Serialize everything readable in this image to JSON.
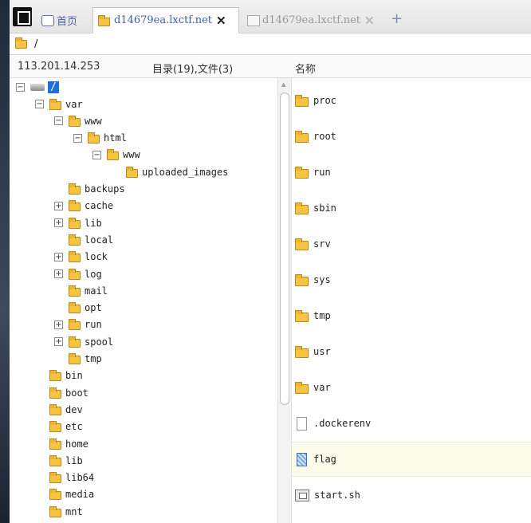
{
  "tabs": {
    "home": "首页",
    "active": "d14679ea.lxctf.net",
    "inactive": "d14679ea.lxctf.net",
    "close": "✕",
    "add": "+"
  },
  "address": {
    "path": "/"
  },
  "header": {
    "ip": "113.201.14.253",
    "counts": "目录(19),文件(3)",
    "name_col": "名称"
  },
  "tree": {
    "root": "/",
    "nodes": [
      {
        "label": "var",
        "toggle": "−"
      },
      {
        "label": "www",
        "toggle": "−"
      },
      {
        "label": "html",
        "toggle": "−"
      },
      {
        "label": "www",
        "toggle": "−"
      },
      {
        "label": "uploaded_images",
        "toggle": ""
      },
      {
        "label": "backups",
        "toggle": ""
      },
      {
        "label": "cache",
        "toggle": "+"
      },
      {
        "label": "lib",
        "toggle": "+"
      },
      {
        "label": "local",
        "toggle": ""
      },
      {
        "label": "lock",
        "toggle": "+"
      },
      {
        "label": "log",
        "toggle": "+"
      },
      {
        "label": "mail",
        "toggle": ""
      },
      {
        "label": "opt",
        "toggle": ""
      },
      {
        "label": "run",
        "toggle": "+"
      },
      {
        "label": "spool",
        "toggle": "+"
      },
      {
        "label": "tmp",
        "toggle": ""
      },
      {
        "label": "bin",
        "toggle": ""
      },
      {
        "label": "boot",
        "toggle": ""
      },
      {
        "label": "dev",
        "toggle": ""
      },
      {
        "label": "etc",
        "toggle": ""
      },
      {
        "label": "home",
        "toggle": ""
      },
      {
        "label": "lib",
        "toggle": ""
      },
      {
        "label": "lib64",
        "toggle": ""
      },
      {
        "label": "media",
        "toggle": ""
      },
      {
        "label": "mnt",
        "toggle": ""
      }
    ]
  },
  "files": [
    {
      "name": "proc",
      "type": "folder"
    },
    {
      "name": "root",
      "type": "folder"
    },
    {
      "name": "run",
      "type": "folder"
    },
    {
      "name": "sbin",
      "type": "folder"
    },
    {
      "name": "srv",
      "type": "folder"
    },
    {
      "name": "sys",
      "type": "folder"
    },
    {
      "name": "tmp",
      "type": "folder"
    },
    {
      "name": "usr",
      "type": "folder"
    },
    {
      "name": "var",
      "type": "folder"
    },
    {
      "name": ".dockerenv",
      "type": "file"
    },
    {
      "name": "flag",
      "type": "flag"
    },
    {
      "name": "start.sh",
      "type": "script"
    }
  ]
}
